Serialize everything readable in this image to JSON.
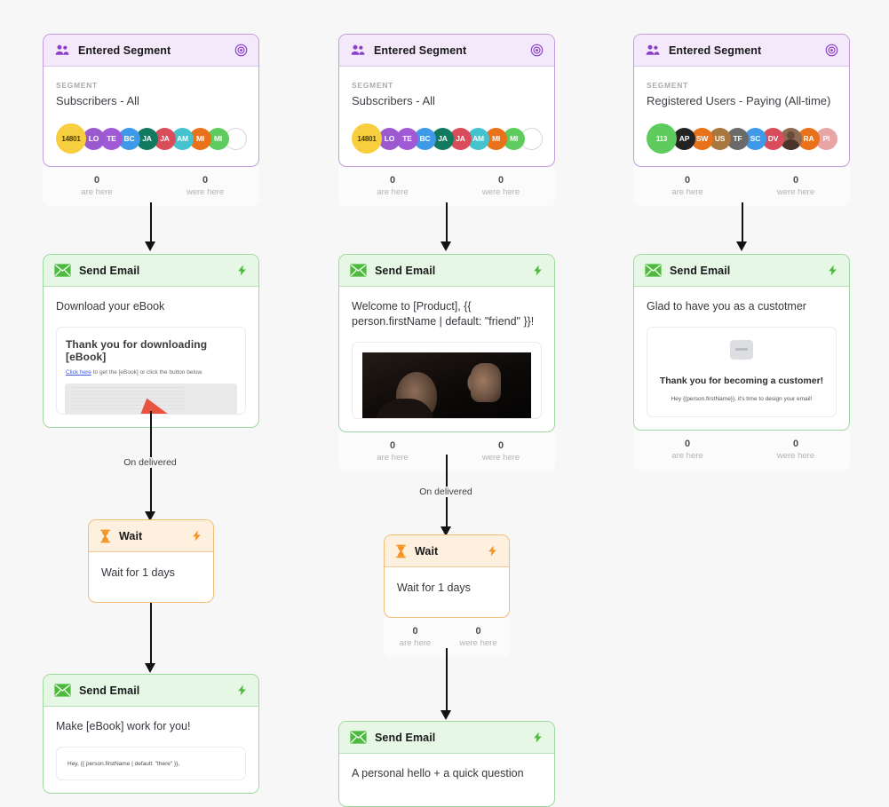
{
  "theme": {
    "canvas_bg": "#f7f7f7",
    "trigger_accent": "#8b3fc9",
    "trigger_border": "#c59ddb",
    "trigger_head_bg": "#f3e9fa",
    "email_accent": "#4cba3c",
    "email_border": "#9fd89f",
    "email_head_bg": "#e7f7e5",
    "wait_accent": "#f59425",
    "wait_border": "#f3bc77",
    "wait_head_bg": "#fdf0df",
    "connector": "#111214"
  },
  "labels": {
    "segment_caption": "SEGMENT",
    "are_here": "are here",
    "were_here": "were here",
    "on_delivered": "On delivered",
    "zero": "0"
  },
  "columns": [
    {
      "id": "column-1",
      "nodes": [
        {
          "kind": "trigger",
          "title": "Entered Segment",
          "icon": "people-icon",
          "action_icon": "target-icon",
          "segment_caption": "SEGMENT",
          "segment_value": "Subscribers - All",
          "count_badge": "14801",
          "count_badge_color": "#f7cf3e",
          "avatars": [
            {
              "initials": "LO",
              "color": "#9b59d0"
            },
            {
              "initials": "TE",
              "color": "#a05ad6"
            },
            {
              "initials": "BC",
              "color": "#3e9ae8"
            },
            {
              "initials": "JA",
              "color": "#117a5e"
            },
            {
              "initials": "JA",
              "color": "#d94c5a"
            },
            {
              "initials": "AM",
              "color": "#44c3ce"
            },
            {
              "initials": "MI",
              "color": "#e8711a"
            },
            {
              "initials": "MI",
              "color": "#5dcb5d"
            },
            {
              "initials": "",
              "color": "#ffffff",
              "ghost": true
            }
          ],
          "stats": {
            "are_here": "0",
            "were_here": "0"
          }
        },
        {
          "kind": "email",
          "title": "Send Email",
          "icon": "mail-icon",
          "action_icon": "bolt-icon",
          "subject": "Download your eBook",
          "preview": {
            "variant": "ebook",
            "heading": "Thank you for downloading [eBook]",
            "link_text": "Click here",
            "body_text": " to get the [eBook] or click the button below."
          },
          "stats": null
        },
        {
          "kind": "wait",
          "title": "Wait",
          "icon": "hourglass-icon",
          "action_icon": "bolt-icon",
          "body": "Wait for 1 days",
          "stats": null,
          "incoming_label": "On delivered"
        },
        {
          "kind": "email",
          "title": "Send Email",
          "icon": "mail-icon",
          "action_icon": "bolt-icon",
          "subject": "Make [eBook] work for you!",
          "preview": {
            "variant": "plain",
            "body_text": "Hey, {{ person.firstName | default: \"there\" }},"
          },
          "stats": null
        }
      ]
    },
    {
      "id": "column-2",
      "nodes": [
        {
          "kind": "trigger",
          "title": "Entered Segment",
          "icon": "people-icon",
          "action_icon": "target-icon",
          "segment_caption": "SEGMENT",
          "segment_value": "Subscribers - All",
          "count_badge": "14801",
          "count_badge_color": "#f7cf3e",
          "avatars": [
            {
              "initials": "LO",
              "color": "#9b59d0"
            },
            {
              "initials": "TE",
              "color": "#a05ad6"
            },
            {
              "initials": "BC",
              "color": "#3e9ae8"
            },
            {
              "initials": "JA",
              "color": "#117a5e"
            },
            {
              "initials": "JA",
              "color": "#d94c5a"
            },
            {
              "initials": "AM",
              "color": "#44c3ce"
            },
            {
              "initials": "MI",
              "color": "#e8711a"
            },
            {
              "initials": "MI",
              "color": "#5dcb5d"
            },
            {
              "initials": "",
              "color": "#ffffff",
              "ghost": true
            }
          ],
          "stats": {
            "are_here": "0",
            "were_here": "0"
          }
        },
        {
          "kind": "email",
          "title": "Send Email",
          "icon": "mail-icon",
          "action_icon": "bolt-icon",
          "subject": "Welcome to [Product], {{ person.firstName | default: \"friend\" }}!",
          "preview": {
            "variant": "gif"
          },
          "stats": {
            "are_here": "0",
            "were_here": "0"
          }
        },
        {
          "kind": "wait",
          "title": "Wait",
          "icon": "hourglass-icon",
          "action_icon": "bolt-icon",
          "body": "Wait for 1 days",
          "stats": {
            "are_here": "0",
            "were_here": "0"
          },
          "incoming_label": "On delivered"
        },
        {
          "kind": "email",
          "title": "Send Email",
          "icon": "mail-icon",
          "action_icon": "bolt-icon",
          "subject": "A personal hello + a quick question",
          "preview": null,
          "stats": null
        }
      ]
    },
    {
      "id": "column-3",
      "nodes": [
        {
          "kind": "trigger",
          "title": "Entered Segment",
          "icon": "people-icon",
          "action_icon": "target-icon",
          "segment_caption": "SEGMENT",
          "segment_value": "Registered Users - Paying (All-time)",
          "count_badge": "113",
          "count_badge_color": "#5dcb5d",
          "avatars": [
            {
              "initials": "AP",
              "color": "#232323"
            },
            {
              "initials": "SW",
              "color": "#e8711a"
            },
            {
              "initials": "US",
              "color": "#a8763f"
            },
            {
              "initials": "TF",
              "color": "#6a6a6a"
            },
            {
              "initials": "SC",
              "color": "#3e9ae8"
            },
            {
              "initials": "DV",
              "color": "#d94c5a"
            },
            {
              "initials": "",
              "color": "#5a4436",
              "photo": true
            },
            {
              "initials": "RA",
              "color": "#e8711a"
            },
            {
              "initials": "PI",
              "color": "#e8a5a5"
            }
          ],
          "stats": {
            "are_here": "0",
            "were_here": "0"
          }
        },
        {
          "kind": "email",
          "title": "Send Email",
          "icon": "mail-icon",
          "action_icon": "bolt-icon",
          "subject": "Glad to have you as a custotmer",
          "preview": {
            "variant": "customer",
            "heading": "Thank you for becoming a customer!",
            "body_text": "Hey {{person.firstName}}, it's time to design your email!"
          },
          "stats": {
            "are_here": "0",
            "were_here": "0"
          }
        }
      ]
    }
  ]
}
